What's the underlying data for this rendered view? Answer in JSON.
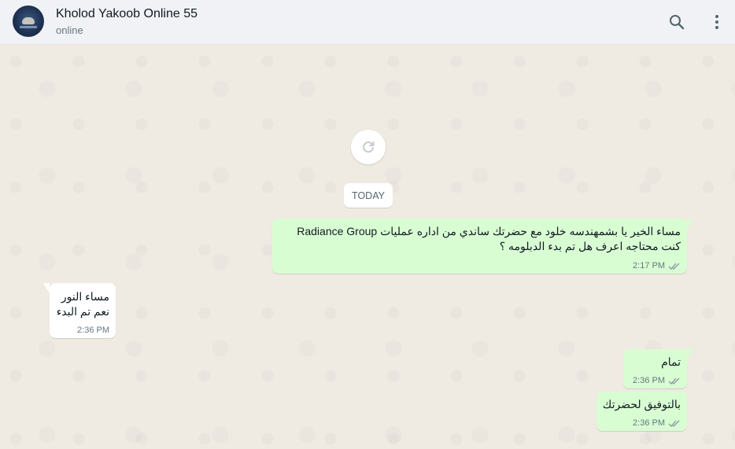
{
  "header": {
    "contact_name": "Kholod Yakoob Online 55",
    "status": "online",
    "icons": {
      "search": "search-icon",
      "menu": "more-vertical-icon",
      "avatar": "contact-avatar"
    }
  },
  "chat": {
    "refresh_icon": "refresh-icon",
    "date_divider": "TODAY",
    "messages": [
      {
        "direction": "outgoing",
        "lines": [
          "مساء الخير يا بشمهندسه خلود مع حضرتك ساندي من اداره عمليات Radiance Group",
          "كنت محتاجه اعرف هل تم بدء الدبلومه ؟"
        ],
        "time": "2:17 PM",
        "status": "double-check-icon"
      },
      {
        "direction": "incoming",
        "lines": [
          "مساء النور",
          "نعم تم البدء"
        ],
        "time": "2:36 PM"
      },
      {
        "direction": "outgoing",
        "lines": [
          "تمام"
        ],
        "time": "2:36 PM",
        "status": "double-check-icon"
      },
      {
        "direction": "outgoing",
        "lines": [
          "بالتوفيق لحضرتك"
        ],
        "time": "2:36 PM",
        "status": "double-check-icon"
      }
    ]
  },
  "colors": {
    "header_bg": "#f0f2f5",
    "chat_bg": "#efeae2",
    "outgoing_bubble": "#d9fdd3",
    "incoming_bubble": "#ffffff",
    "read_tick": "#8696a0"
  }
}
